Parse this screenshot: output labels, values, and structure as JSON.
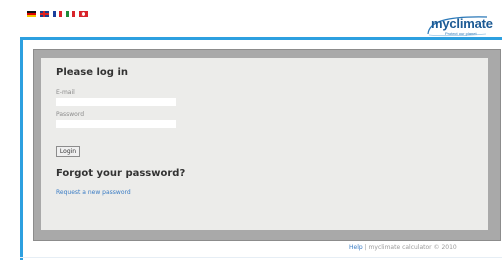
{
  "languages": [
    "de",
    "gb",
    "fr",
    "it",
    "tr"
  ],
  "logo": {
    "name": "myclimate",
    "tagline": "Protect our planet"
  },
  "login": {
    "heading": "Please log in",
    "email_label": "E-mail",
    "email_value": "",
    "password_label": "Password",
    "password_value": "",
    "button_label": "Login"
  },
  "forgot": {
    "heading": "Forgot your password?",
    "link_text": "Request a new password"
  },
  "footer": {
    "help_link": "Help",
    "separator": "|",
    "credit": "myclimate calculator © 2010"
  },
  "colors": {
    "accent_blue": "#2da0e0",
    "logo_blue": "#1c5a94",
    "link_blue": "#3a7cc4"
  }
}
